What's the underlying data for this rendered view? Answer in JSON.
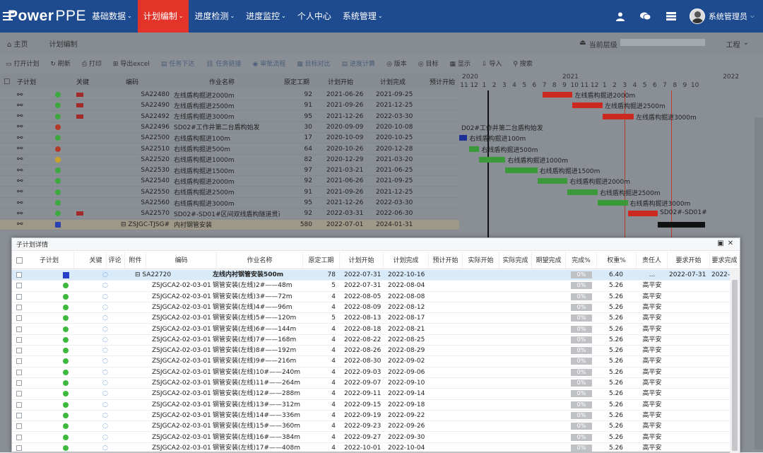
{
  "brand": {
    "bold": "Power",
    "light": "PPE"
  },
  "nav": [
    {
      "label": "基础数据",
      "chev": true,
      "active": false
    },
    {
      "label": "计划编制",
      "chev": true,
      "active": true
    },
    {
      "label": "进度检测",
      "chev": true,
      "active": false
    },
    {
      "label": "进度监控",
      "chev": true,
      "active": false
    },
    {
      "label": "个人中心",
      "chev": false,
      "active": false
    },
    {
      "label": "系统管理",
      "chev": true,
      "active": false
    }
  ],
  "user": {
    "name": "系统管理员",
    "chev": "⌵"
  },
  "breadcrumb": {
    "home": "主页",
    "current": "计划编制",
    "level_label": "当前层级",
    "level_suffix": "工程"
  },
  "toolbar": [
    "打开计划",
    "刷新",
    "打印",
    "导出excel",
    "任务下达",
    "任务链接",
    "审批流程",
    "目标对比",
    "进度计算",
    "版本",
    "目标",
    "显示",
    "导入",
    "搜索"
  ],
  "main_headers": {
    "sub": "子计划",
    "key": "关键",
    "code": "编码",
    "name": "作业名称",
    "dur": "原定工期",
    "start": "计划开始",
    "end": "计划完成",
    "est": "预计开始"
  },
  "gantt": {
    "years": [
      {
        "label": "2020",
        "col": 0
      },
      {
        "label": "2021",
        "col": 10
      },
      {
        "label": "2022",
        "col": 26
      }
    ],
    "months": [
      "11",
      "12",
      "1",
      "2",
      "3",
      "4",
      "5",
      "6",
      "7",
      "8",
      "9",
      "10",
      "11",
      "12",
      "1",
      "2",
      "3",
      "4",
      "5",
      "6",
      "7",
      "8",
      "9",
      "10"
    ]
  },
  "main_rows": [
    {
      "dot": "#3da83d",
      "flag": true,
      "code": "SA22480",
      "name": "左线盾构掘进2000m",
      "dur": "92",
      "start": "2021-06-26",
      "end": "2021-09-25"
    },
    {
      "dot": "#3da83d",
      "flag": true,
      "code": "SA22490",
      "name": "左线盾构掘进2500m",
      "dur": "91",
      "start": "2021-09-26",
      "end": "2021-12-25"
    },
    {
      "dot": "#3da83d",
      "flag": true,
      "code": "SA22492",
      "name": "左线盾构掘进3000m",
      "dur": "95",
      "start": "2021-12-26",
      "end": "2022-03-30"
    },
    {
      "dot": "#b23a2a",
      "flag": false,
      "code": "SA22496",
      "name": "SD02#工作井第二台盾构始发",
      "dur": "30",
      "start": "2020-09-09",
      "end": "2020-10-08"
    },
    {
      "dot": "#3da83d",
      "flag": false,
      "code": "SA22500",
      "name": "右线盾构掘进100m",
      "dur": "17",
      "start": "2020-10-09",
      "end": "2020-10-25"
    },
    {
      "dot": "#b23a2a",
      "flag": false,
      "code": "SA22510",
      "name": "右线盾构掘进500m",
      "dur": "64",
      "start": "2020-10-26",
      "end": "2020-12-28"
    },
    {
      "dot": "#c9a32a",
      "flag": false,
      "code": "SA22520",
      "name": "右线盾构掘进1000m",
      "dur": "82",
      "start": "2020-12-29",
      "end": "2021-03-20"
    },
    {
      "dot": "#3da83d",
      "flag": false,
      "code": "SA22530",
      "name": "右线盾构掘进1500m",
      "dur": "97",
      "start": "2021-03-21",
      "end": "2021-06-25"
    },
    {
      "dot": "#3da83d",
      "flag": false,
      "code": "SA22540",
      "name": "右线盾构掘进2000m",
      "dur": "92",
      "start": "2021-06-26",
      "end": "2021-09-25"
    },
    {
      "dot": "#3da83d",
      "flag": false,
      "code": "SA22550",
      "name": "右线盾构掘进2500m",
      "dur": "91",
      "start": "2021-09-26",
      "end": "2021-12-25"
    },
    {
      "dot": "#3da83d",
      "flag": false,
      "code": "SA22560",
      "name": "右线盾构掘进3000m",
      "dur": "95",
      "start": "2021-12-26",
      "end": "2022-03-30"
    },
    {
      "dot": "#3da83d",
      "flag": true,
      "code": "SA22570",
      "name": "SD02#-SD01#区间双线盾构隧道贯通",
      "dur": "92",
      "start": "2022-03-31",
      "end": "2022-06-30"
    },
    {
      "dot": "",
      "flag": false,
      "code": "⊟ ZSJGC-TJSG#",
      "name": "内衬钢管安装",
      "dur": "580",
      "start": "2022-07-01",
      "end": "2024-01-31",
      "hl": true
    }
  ],
  "gantt_bars": [
    {
      "row": 0,
      "from": 8.3,
      "to": 11.3,
      "color": "#cc2a20",
      "label": "左线盾构掘进2000m"
    },
    {
      "row": 1,
      "from": 11.3,
      "to": 14.3,
      "color": "#cc2a20",
      "label": "左线盾构掘进2500m"
    },
    {
      "row": 2,
      "from": 14.3,
      "to": 17.4,
      "color": "#cc2a20",
      "label": "左线盾构掘进3000m"
    },
    {
      "row": 3,
      "from": 0,
      "to": 0,
      "color": "",
      "label": "D02#工作井第二台盾构始发"
    },
    {
      "row": 4,
      "from": 0,
      "to": 0.8,
      "color": "#1f2f9a",
      "label": "右线盾构掘进100m"
    },
    {
      "row": 5,
      "from": 1.0,
      "to": 2.0,
      "color": "#3a9a3a",
      "label": "右线盾构掘进500m"
    },
    {
      "row": 6,
      "from": 2.0,
      "to": 4.6,
      "color": "#3a9a3a",
      "label": "右线盾构掘进1000m"
    },
    {
      "row": 7,
      "from": 4.6,
      "to": 7.8,
      "color": "#3a9a3a",
      "label": "右线盾构掘进1500m"
    },
    {
      "row": 8,
      "from": 7.8,
      "to": 10.8,
      "color": "#3a9a3a",
      "label": "右线盾构掘进2000m"
    },
    {
      "row": 9,
      "from": 10.8,
      "to": 13.8,
      "color": "#3a9a3a",
      "label": "右线盾构掘进2500m"
    },
    {
      "row": 10,
      "from": 13.8,
      "to": 16.8,
      "color": "#3a9a3a",
      "label": "右线盾构掘进3000m"
    },
    {
      "row": 11,
      "from": 16.8,
      "to": 19.8,
      "color": "#cc2a20",
      "label": "SD02#-SD01#"
    },
    {
      "row": 12,
      "from": 19.8,
      "to": 24.5,
      "color": "#111111",
      "label": ""
    }
  ],
  "dialog": {
    "title": "子计划详情",
    "headers": [
      "子计划",
      "关键",
      "评论",
      "附件",
      "编码",
      "作业名称",
      "原定工期",
      "计划开始",
      "计划完成",
      "预计开始",
      "实际开始",
      "实际完成",
      "期望完成",
      "完成%",
      "权重%",
      "责任人",
      "要求开始",
      "要求完成"
    ],
    "rows": [
      {
        "code": "⊟ SA22720",
        "name": "左线内衬钢管安装500m",
        "dur": "78",
        "start": "2022-07-31",
        "end": "2022-10-16",
        "pct": "0%",
        "weight": "6.40",
        "owner": "...",
        "req_start": "2022-07-31",
        "req_end": "2022-"
      },
      {
        "code": "ZSJGCA2-02-03-01",
        "name": "钢管安装(左线)2#——48m",
        "dur": "5",
        "start": "2022-07-31",
        "end": "2022-08-04",
        "pct": "0%",
        "weight": "5.26",
        "owner": "高平安",
        "req_start": "",
        "req_end": ""
      },
      {
        "code": "ZSJGCA2-02-03-01",
        "name": "钢管安装(左线)3#——72m",
        "dur": "4",
        "start": "2022-08-05",
        "end": "2022-08-08",
        "pct": "0%",
        "weight": "5.26",
        "owner": "高平安",
        "req_start": "",
        "req_end": ""
      },
      {
        "code": "ZSJGCA2-02-03-01",
        "name": "钢管安装(左线)4#——96m",
        "dur": "4",
        "start": "2022-08-09",
        "end": "2022-08-12",
        "pct": "0%",
        "weight": "5.26",
        "owner": "高平安",
        "req_start": "",
        "req_end": ""
      },
      {
        "code": "ZSJGCA2-02-03-01",
        "name": "钢管安装(左线)5#——120m",
        "dur": "5",
        "start": "2022-08-13",
        "end": "2022-08-17",
        "pct": "0%",
        "weight": "5.26",
        "owner": "高平安",
        "req_start": "",
        "req_end": ""
      },
      {
        "code": "ZSJGCA2-02-03-01",
        "name": "钢管安装(左线)6#——144m",
        "dur": "4",
        "start": "2022-08-18",
        "end": "2022-08-21",
        "pct": "0%",
        "weight": "5.26",
        "owner": "高平安",
        "req_start": "",
        "req_end": ""
      },
      {
        "code": "ZSJGCA2-02-03-01",
        "name": "钢管安装(左线)7#——168m",
        "dur": "4",
        "start": "2022-08-22",
        "end": "2022-08-25",
        "pct": "0%",
        "weight": "5.26",
        "owner": "高平安",
        "req_start": "",
        "req_end": ""
      },
      {
        "code": "ZSJGCA2-02-03-01",
        "name": "钢管安装(左线)8#——192m",
        "dur": "4",
        "start": "2022-08-26",
        "end": "2022-08-29",
        "pct": "0%",
        "weight": "5.26",
        "owner": "高平安",
        "req_start": "",
        "req_end": ""
      },
      {
        "code": "ZSJGCA2-02-03-01",
        "name": "钢管安装(左线)9#——216m",
        "dur": "4",
        "start": "2022-08-30",
        "end": "2022-09-02",
        "pct": "0%",
        "weight": "5.26",
        "owner": "高平安",
        "req_start": "",
        "req_end": ""
      },
      {
        "code": "ZSJGCA2-02-03-01",
        "name": "钢管安装(左线)10#——240m",
        "dur": "4",
        "start": "2022-09-03",
        "end": "2022-09-06",
        "pct": "0%",
        "weight": "5.26",
        "owner": "高平安",
        "req_start": "",
        "req_end": ""
      },
      {
        "code": "ZSJGCA2-02-03-01",
        "name": "钢管安装(左线)11#——264m",
        "dur": "4",
        "start": "2022-09-07",
        "end": "2022-09-10",
        "pct": "0%",
        "weight": "5.26",
        "owner": "高平安",
        "req_start": "",
        "req_end": ""
      },
      {
        "code": "ZSJGCA2-02-03-01",
        "name": "钢管安装(左线)12#——288m",
        "dur": "4",
        "start": "2022-09-11",
        "end": "2022-09-14",
        "pct": "0%",
        "weight": "5.26",
        "owner": "高平安",
        "req_start": "",
        "req_end": ""
      },
      {
        "code": "ZSJGCA2-02-03-01",
        "name": "钢管安装(左线)13#——312m",
        "dur": "4",
        "start": "2022-09-15",
        "end": "2022-09-18",
        "pct": "0%",
        "weight": "5.26",
        "owner": "高平安",
        "req_start": "",
        "req_end": ""
      },
      {
        "code": "ZSJGCA2-02-03-01",
        "name": "钢管安装(左线)14#——336m",
        "dur": "4",
        "start": "2022-09-19",
        "end": "2022-09-22",
        "pct": "0%",
        "weight": "5.26",
        "owner": "高平安",
        "req_start": "",
        "req_end": ""
      },
      {
        "code": "ZSJGCA2-02-03-01",
        "name": "钢管安装(左线)15#——360m",
        "dur": "4",
        "start": "2022-09-23",
        "end": "2022-09-26",
        "pct": "0%",
        "weight": "5.26",
        "owner": "高平安",
        "req_start": "",
        "req_end": ""
      },
      {
        "code": "ZSJGCA2-02-03-01",
        "name": "钢管安装(左线)16#——384m",
        "dur": "4",
        "start": "2022-09-27",
        "end": "2022-09-30",
        "pct": "0%",
        "weight": "5.26",
        "owner": "高平安",
        "req_start": "",
        "req_end": ""
      },
      {
        "code": "ZSJGCA2-02-03-01",
        "name": "钢管安装(左线)17#——408m",
        "dur": "4",
        "start": "2022-10-01",
        "end": "2022-10-04",
        "pct": "0%",
        "weight": "5.26",
        "owner": "高平安",
        "req_start": "",
        "req_end": ""
      }
    ]
  }
}
